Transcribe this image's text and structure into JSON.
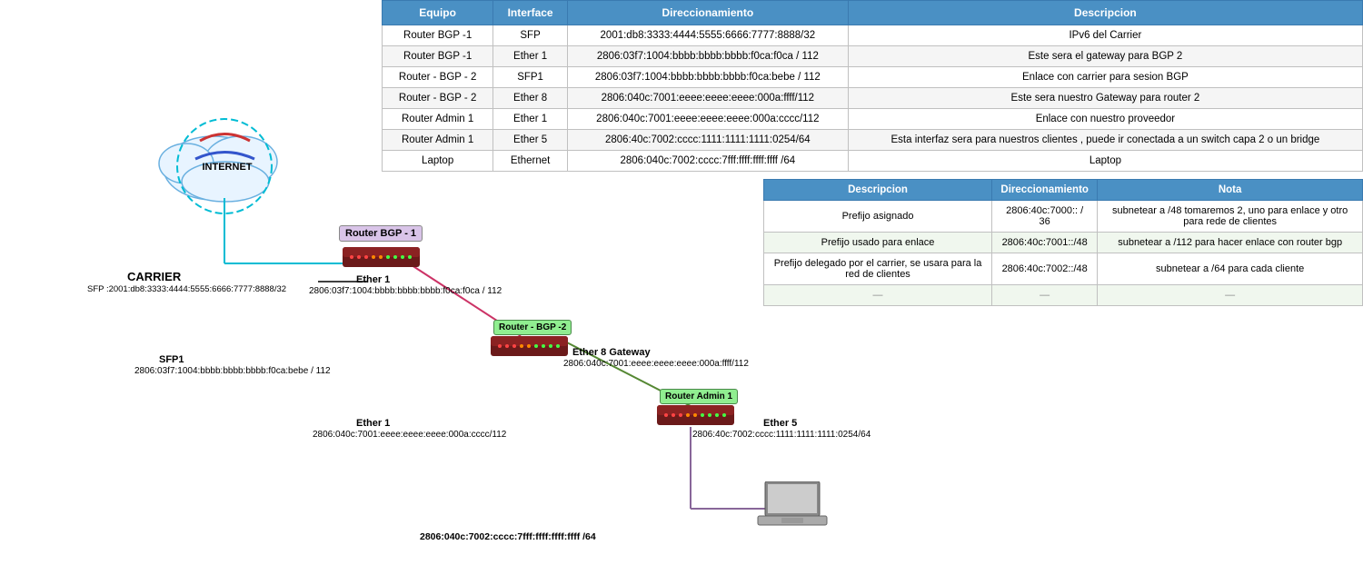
{
  "tables": {
    "main": {
      "headers": [
        "Equipo",
        "Interface",
        "Direccionamiento",
        "Descripcion"
      ],
      "rows": [
        {
          "equipo": "Router BGP -1",
          "interface": "SFP",
          "direccionamiento": "2001:db8:3333:4444:5555:6666:7777:8888/32",
          "descripcion": "IPv6 del Carrier"
        },
        {
          "equipo": "Router BGP -1",
          "interface": "Ether 1",
          "direccionamiento": "2806:03f7:1004:bbbb:bbbb:bbbb:f0ca:f0ca / 112",
          "descripcion": "Este sera el gateway para BGP 2"
        },
        {
          "equipo": "Router - BGP - 2",
          "interface": "SFP1",
          "direccionamiento": "2806:03f7:1004:bbbb:bbbb:bbbb:f0ca:bebe / 112",
          "descripcion": "Enlace con carrier para sesion BGP"
        },
        {
          "equipo": "Router - BGP - 2",
          "interface": "Ether 8",
          "direccionamiento": "2806:040c:7001:eeee:eeee:eeee:000a:ffff/112",
          "descripcion": "Este sera nuestro Gateway para router 2"
        },
        {
          "equipo": "Router Admin 1",
          "interface": "Ether 1",
          "direccionamiento": "2806:040c:7001:eeee:eeee:eeee:000a:cccc/112",
          "descripcion": "Enlace con nuestro proveedor"
        },
        {
          "equipo": "Router Admin 1",
          "interface": "Ether 5",
          "direccionamiento": "2806:40c:7002:cccc:1111:1111:1111:0254/64",
          "descripcion": "Esta interfaz sera para nuestros clientes , puede ir conectada a un switch capa 2 o un bridge"
        },
        {
          "equipo": "Laptop",
          "interface": "Ethernet",
          "direccionamiento": "2806:040c:7002:cccc:7fff:ffff:ffff:ffff /64",
          "descripcion": "Laptop"
        }
      ]
    },
    "second": {
      "headers": [
        "Descripcion",
        "Direccionamiento",
        "Nota"
      ],
      "rows": [
        {
          "descripcion": "Prefijo asignado",
          "direccionamiento": "2806:40c:7000:: / 36",
          "nota": "subnetear a /48  tomaremos 2, uno para enlace y otro para rede de clientes"
        },
        {
          "descripcion": "Prefijo usado para enlace",
          "direccionamiento": "2806:40c:7001::/48",
          "nota": "subnetear a /112 para hacer enlace con router bgp"
        },
        {
          "descripcion": "Prefijo delegado por el carrier, se usara para la red de clientes",
          "direccionamiento": "2806:40c:7002::/48",
          "nota": "subnetear a /64 para cada cliente"
        },
        {
          "descripcion": "—",
          "direccionamiento": "—",
          "nota": "—"
        }
      ]
    }
  },
  "diagram": {
    "internet_label": "INTERNET",
    "carrier_label": "CARRIER",
    "carrier_sfp": "SFP :2001:db8:3333:4444:5555:6666:7777:8888/32",
    "bgp1_label": "Router BGP -\n1",
    "bgp2_label": "Router - BGP -2",
    "admin1_label": "Router Admin 1",
    "bgp1_ether1_label": "Ether 1",
    "bgp1_ether1_ip": "2806:03f7:1004:bbbb:bbbb:bbbb:f0ca:f0ca / 112",
    "bgp2_sfp1_label": "SFP1",
    "bgp2_sfp1_ip": "2806:03f7:1004:bbbb:bbbb:bbbb:f0ca:bebe / 112",
    "bgp2_ether8_label": "Ether 8 Gateway",
    "bgp2_ether8_ip": "2806:040c:7001:eeee:eeee:eeee:000a:ffff/112",
    "admin1_ether1_label": "Ether 1",
    "admin1_ether1_ip": "2806:040c:7001:eeee:eeee:eeee:000a:cccc/112",
    "admin1_ether5_label": "Ether 5",
    "admin1_ether5_ip": "2806:40c:7002:cccc:1111:1111:1111:0254/64",
    "laptop_ip": "2806:040c:7002:cccc:7fff:ffff:ffff:ffff /64",
    "laptop_label": "Laptop"
  }
}
